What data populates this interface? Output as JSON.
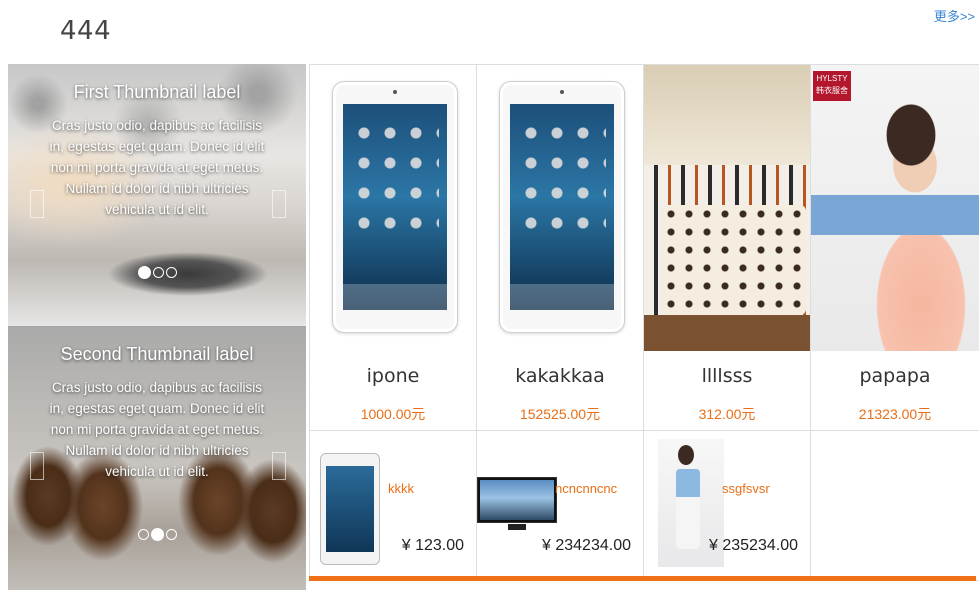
{
  "section": {
    "title": "444",
    "more_label": "更多>>"
  },
  "carousels": [
    {
      "title": "First Thumbnail label",
      "text": "Cras justo odio, dapibus ac facilisis in, egestas eget quam. Donec id elit non mi porta gravida at eget metus. Nullam id dolor id nibh ultricies vehicula ut id elit.",
      "active_dot": 0,
      "dot_count": 3
    },
    {
      "title": "Second Thumbnail label",
      "text": "Cras justo odio, dapibus ac facilisis in, egestas eget quam. Donec id elit non mi porta gravida at eget metus. Nullam id dolor id nibh ultricies vehicula ut id elit.",
      "active_dot": 1,
      "dot_count": 3
    }
  ],
  "featured_products": [
    {
      "name": "ipone",
      "price": "1000.00元",
      "image": "ipad"
    },
    {
      "name": "kakakkaa",
      "price": "152525.00元",
      "image": "ipad"
    },
    {
      "name": "llllsss",
      "price": "312.00元",
      "image": "bedroom"
    },
    {
      "name": "papapa",
      "price": "21323.00元",
      "image": "fashion"
    }
  ],
  "small_products": [
    {
      "name": "kkkk",
      "price": "¥ 123.00",
      "image": "ipad"
    },
    {
      "name": "ncncnncnc",
      "price": "¥ 234234.00",
      "image": "tv"
    },
    {
      "name": "ssgfsvsr",
      "price": "¥ 235234.00",
      "image": "girl"
    }
  ],
  "brand_badge": "HYLSTY 韩衣服舍",
  "colors": {
    "accent": "#f0701a",
    "price": "#e86f19",
    "link": "#3a84d6"
  }
}
